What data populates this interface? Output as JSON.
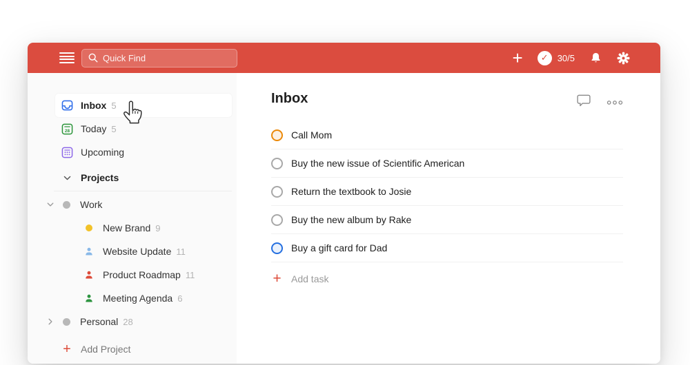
{
  "colors": {
    "header": "#db4c3f",
    "inbox_icon": "#316fea",
    "today_icon": "#299438",
    "upcoming_icon": "#8c67e8",
    "work_dot": "#b8b8b8",
    "new_brand_dot": "#f2c229",
    "website_person": "#88b8e8",
    "product_person": "#dd4b39",
    "meeting_person": "#2d9440",
    "personal_dot": "#b8b8b8",
    "accent_red": "#dd4b39"
  },
  "topbar": {
    "search_placeholder": "Quick Find",
    "karma_score": "30/5",
    "check_glyph": "✓",
    "plus_glyph": "+"
  },
  "sidebar": {
    "items": [
      {
        "label": "Inbox",
        "count": "5"
      },
      {
        "label": "Today",
        "count": "5",
        "date_number": "28"
      },
      {
        "label": "Upcoming",
        "count": ""
      }
    ],
    "projects_header": "Projects",
    "projects": [
      {
        "label": "Work",
        "count": ""
      },
      {
        "label": "New Brand",
        "count": "9"
      },
      {
        "label": "Website Update",
        "count": "11"
      },
      {
        "label": "Product Roadmap",
        "count": "11"
      },
      {
        "label": "Meeting Agenda",
        "count": "6"
      },
      {
        "label": "Personal",
        "count": "28"
      }
    ],
    "add_project_label": "Add Project",
    "plus_glyph": "+"
  },
  "main": {
    "title": "Inbox",
    "tasks": [
      {
        "title": "Call Mom",
        "ring": "#eb8909",
        "fill": "#fcf0e3"
      },
      {
        "title": "Buy the new issue of Scientific American",
        "ring": "#a8a8a8",
        "fill": "#ffffff"
      },
      {
        "title": "Return the textbook to Josie",
        "ring": "#a8a8a8",
        "fill": "#ffffff"
      },
      {
        "title": "Buy the new album by Rake",
        "ring": "#a8a8a8",
        "fill": "#ffffff"
      },
      {
        "title": "Buy a gift card for Dad",
        "ring": "#246fe0",
        "fill": "#e9f1fc"
      }
    ],
    "add_task_label": "Add task",
    "plus_glyph": "+"
  }
}
